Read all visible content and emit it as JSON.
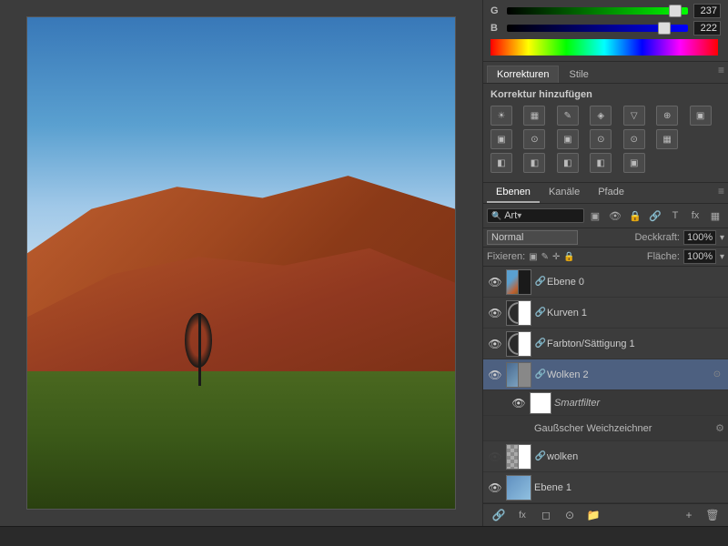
{
  "colors": {
    "g_value": "237",
    "b_value": "222"
  },
  "corrections": {
    "tab_korrekturen": "Korrekturen",
    "tab_stile": "Stile",
    "title": "Korrektur hinzufügen",
    "icons_row1": [
      "☀",
      "▦",
      "✎",
      "◈",
      "▽",
      "⊕"
    ],
    "icons_row2": [
      "▣",
      "⊙",
      "▣",
      "⊙",
      "⊙",
      "▦"
    ],
    "icons_row3": [
      "◧",
      "◧",
      "◧",
      "◧",
      "▣"
    ]
  },
  "layers": {
    "tab_ebenen": "Ebenen",
    "tab_kanaele": "Kanäle",
    "tab_pfade": "Pfade",
    "search_label": "Art",
    "blend_mode": "Normal",
    "opacity_label": "Deckkraft:",
    "opacity_value": "100%",
    "fixieren_label": "Fixieren:",
    "fill_label": "Fläche:",
    "fill_value": "100%",
    "items": [
      {
        "name": "Ebene 0",
        "type": "image",
        "visible": true,
        "linked": true,
        "has_mask": true
      },
      {
        "name": "Kurven 1",
        "type": "curves",
        "visible": true,
        "linked": true,
        "has_mask": true
      },
      {
        "name": "Farbton/Sättigung 1",
        "type": "hue",
        "visible": true,
        "linked": true,
        "has_mask": true
      },
      {
        "name": "Wolken 2",
        "type": "smart",
        "visible": true,
        "linked": true,
        "active": true,
        "has_mask": true,
        "subfilters": [
          {
            "name": "Smartfilter",
            "type": "label"
          },
          {
            "name": "Gaußscher Weichzeichner",
            "type": "filter"
          }
        ]
      },
      {
        "name": "wolken",
        "type": "checker",
        "visible": false,
        "linked": true,
        "has_mask": true,
        "visible_eye": false
      },
      {
        "name": "Ebene 1",
        "type": "blue",
        "visible": true,
        "linked": false,
        "has_mask": false
      }
    ],
    "bottom_icons": [
      "🔗",
      "fx",
      "◻",
      "⊙",
      "📁",
      "🗑"
    ]
  },
  "statusbar": {
    "text": ""
  }
}
